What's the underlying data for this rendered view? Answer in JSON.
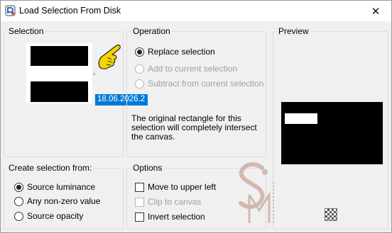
{
  "window": {
    "title": "Load Selection From Disk",
    "close_glyph": "✕"
  },
  "selection": {
    "label": "Selection",
    "file_name": "18.06.2026.2",
    "dropdown_glyph": "▾"
  },
  "operation": {
    "label": "Operation",
    "options": [
      {
        "label": "Replace selection",
        "checked": true,
        "enabled": true
      },
      {
        "label": "Add to current selection",
        "checked": false,
        "enabled": false
      },
      {
        "label": "Subtract from current selection",
        "checked": false,
        "enabled": false
      }
    ],
    "description": "The original rectangle for this selection will completely intersect the canvas."
  },
  "preview": {
    "label": "Preview"
  },
  "create_from": {
    "label": "Create selection from:",
    "options": [
      {
        "label": "Source luminance",
        "checked": true
      },
      {
        "label": "Any non-zero value",
        "checked": false
      },
      {
        "label": "Source opacity",
        "checked": false
      }
    ]
  },
  "options": {
    "label": "Options",
    "items": [
      {
        "label": "Move to upper left",
        "checked": false,
        "enabled": true
      },
      {
        "label": "Clip to canvas",
        "checked": false,
        "enabled": false
      },
      {
        "label": "Invert selection",
        "checked": false,
        "enabled": true
      }
    ]
  },
  "icons": {
    "app": "app-icon",
    "pointer": "pointing-hand-icon",
    "watermark": "sim-watermark-logo",
    "checker": "transparency-checker-icon"
  },
  "colors": {
    "accent": "#0078d7",
    "pointer": "#f5d400",
    "watermark": "#c9a79b"
  }
}
